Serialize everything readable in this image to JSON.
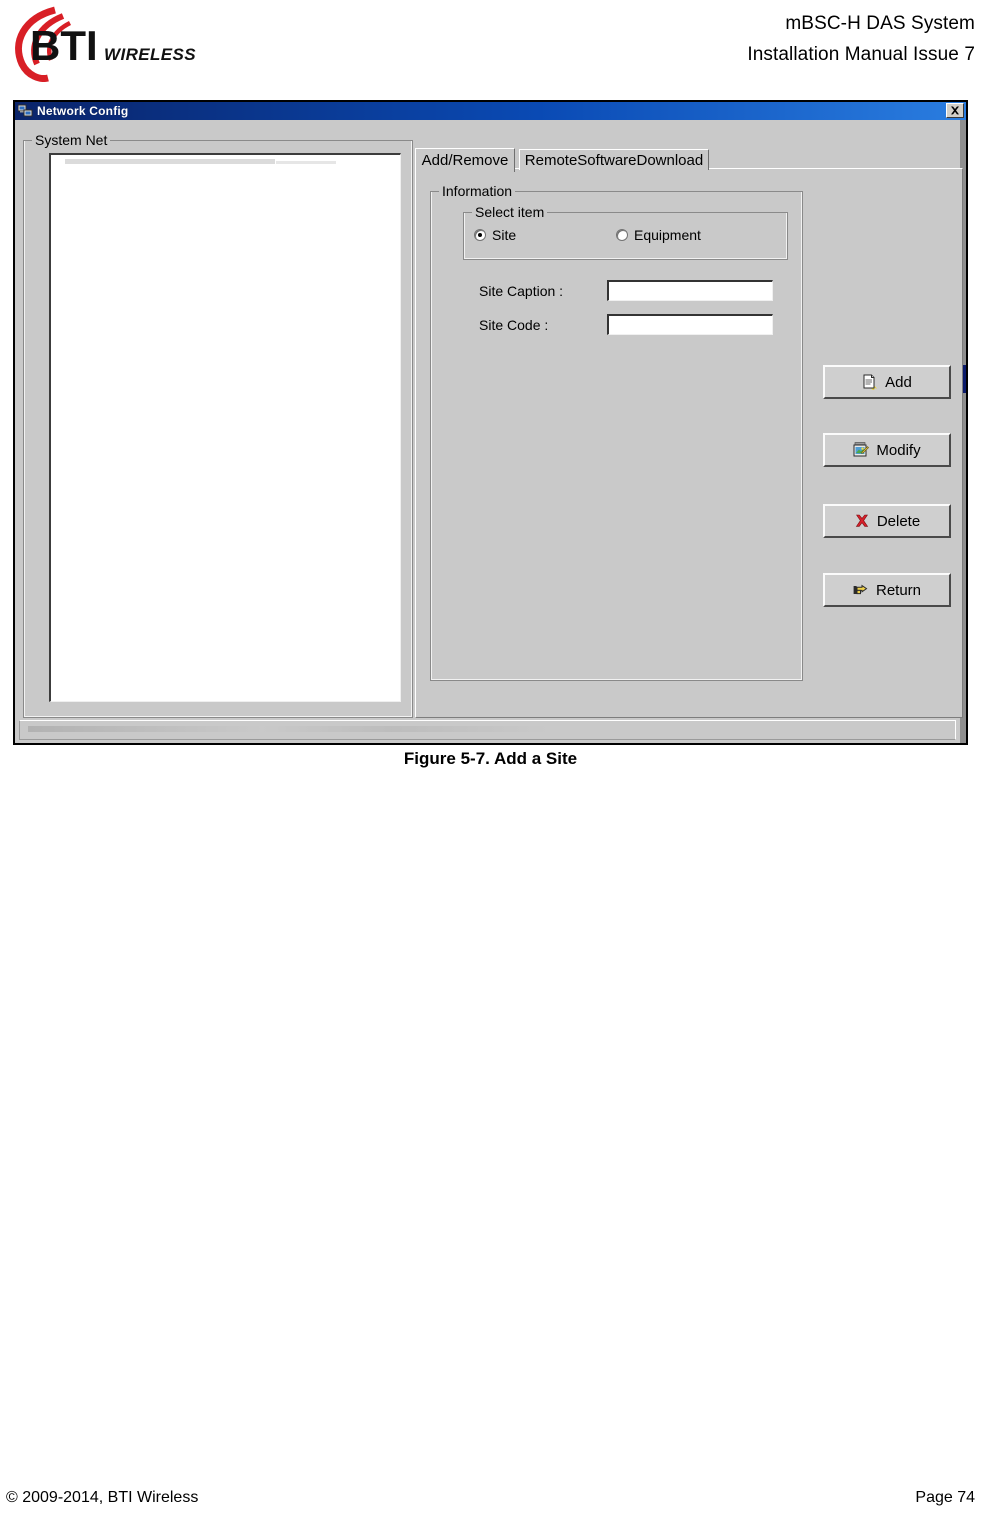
{
  "header": {
    "logo_text": "BTI",
    "logo_subtext": "WIRELESS",
    "logo_color": "#d81f26",
    "title_line1": "mBSC-H DAS System",
    "title_line2": "Installation Manual Issue 7"
  },
  "dialog": {
    "title": "Network Config",
    "title_icon": "network-computers-icon",
    "close_label": "✕",
    "titlebar_color": "#0a246a",
    "face_color": "#c9c9c9",
    "left_group": {
      "title": "System Net",
      "tree_items": []
    },
    "tabs": [
      {
        "label": "Add/Remove",
        "active": true
      },
      {
        "label": "RemoteSoftwareDownload",
        "active": false
      }
    ],
    "information": {
      "title": "Information",
      "select_item": {
        "title": "Select item",
        "options": [
          {
            "label": "Site",
            "selected": true
          },
          {
            "label": "Equipment",
            "selected": false
          }
        ]
      },
      "fields": [
        {
          "label": "Site Caption :",
          "value": "",
          "placeholder": ""
        },
        {
          "label": "Site Code :",
          "value": "",
          "placeholder": ""
        }
      ]
    },
    "buttons": [
      {
        "label": "Add",
        "icon": "new-document-icon"
      },
      {
        "label": "Modify",
        "icon": "edit-properties-icon"
      },
      {
        "label": "Delete",
        "icon": "red-x-icon"
      },
      {
        "label": "Return",
        "icon": "pointing-hand-icon"
      }
    ],
    "statusbar": {
      "text": ""
    }
  },
  "figure": {
    "caption": "Figure 5-7. Add a Site"
  },
  "footer": {
    "copyright": "© 2009-2014, BTI Wireless",
    "page": "Page 74"
  }
}
